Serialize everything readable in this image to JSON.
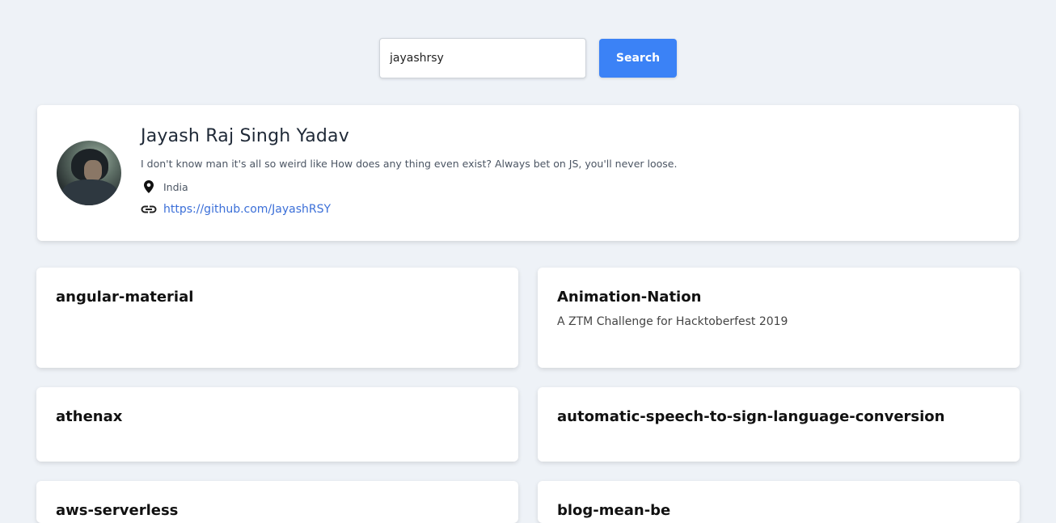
{
  "search": {
    "value": "jayashrsy",
    "button_label": "Search"
  },
  "profile": {
    "name": "Jayash Raj Singh Yadav",
    "bio": "I don't know man it's all so weird like How does any thing even exist? Always bet on JS, you'll never loose.",
    "location": "India",
    "url": "https://github.com/JayashRSY",
    "location_icon": "map-pin-icon",
    "link_icon": "link-icon"
  },
  "repos": [
    {
      "name": "angular-material",
      "description": ""
    },
    {
      "name": "Animation-Nation",
      "description": "A ZTM Challenge for Hacktoberfest 2019"
    },
    {
      "name": "athenax",
      "description": ""
    },
    {
      "name": "automatic-speech-to-sign-language-conversion",
      "description": ""
    },
    {
      "name": "aws-serverless",
      "description": ""
    },
    {
      "name": "blog-mean-be",
      "description": ""
    }
  ],
  "colors": {
    "background": "#eef2f7",
    "accent": "#3b82f6",
    "link": "#3b6fd8"
  }
}
